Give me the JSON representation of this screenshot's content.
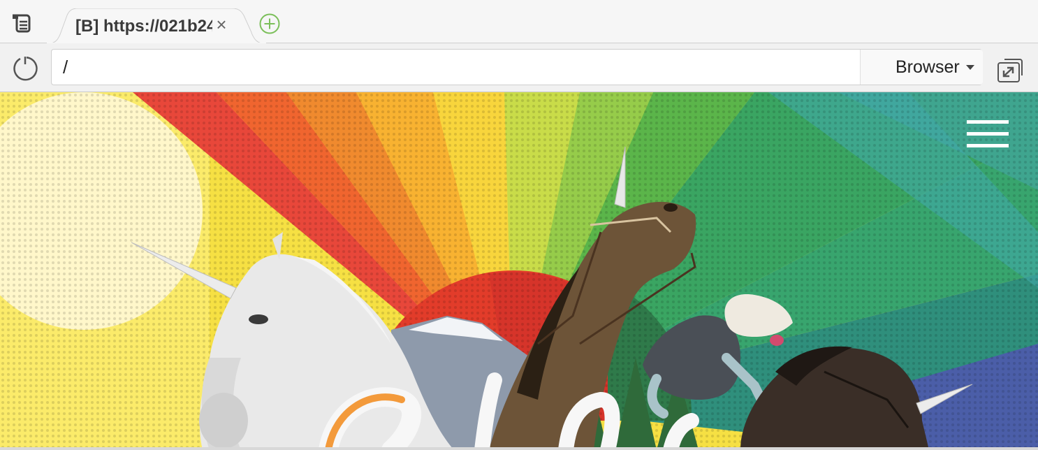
{
  "tabs": [
    {
      "title": "[B] https://021b24",
      "close_symbol": "×"
    }
  ],
  "address_bar": {
    "value": "/",
    "engine_label": "Browser"
  },
  "icons": {
    "menu": "tab-list-icon",
    "new_tab": "plus-circle-icon",
    "reload": "reload-icon",
    "dropdown": "caret-down-icon",
    "popout": "external-window-icon",
    "site_menu": "hamburger-menu-icon"
  },
  "colors": {
    "new_tab_green": "#7bbf5a",
    "rainbow": [
      "#e8473a",
      "#f08a2e",
      "#f8c531",
      "#f6e64b",
      "#b7d744",
      "#6dbd49",
      "#3aa562",
      "#2fa0a8",
      "#4b7fc0"
    ]
  }
}
